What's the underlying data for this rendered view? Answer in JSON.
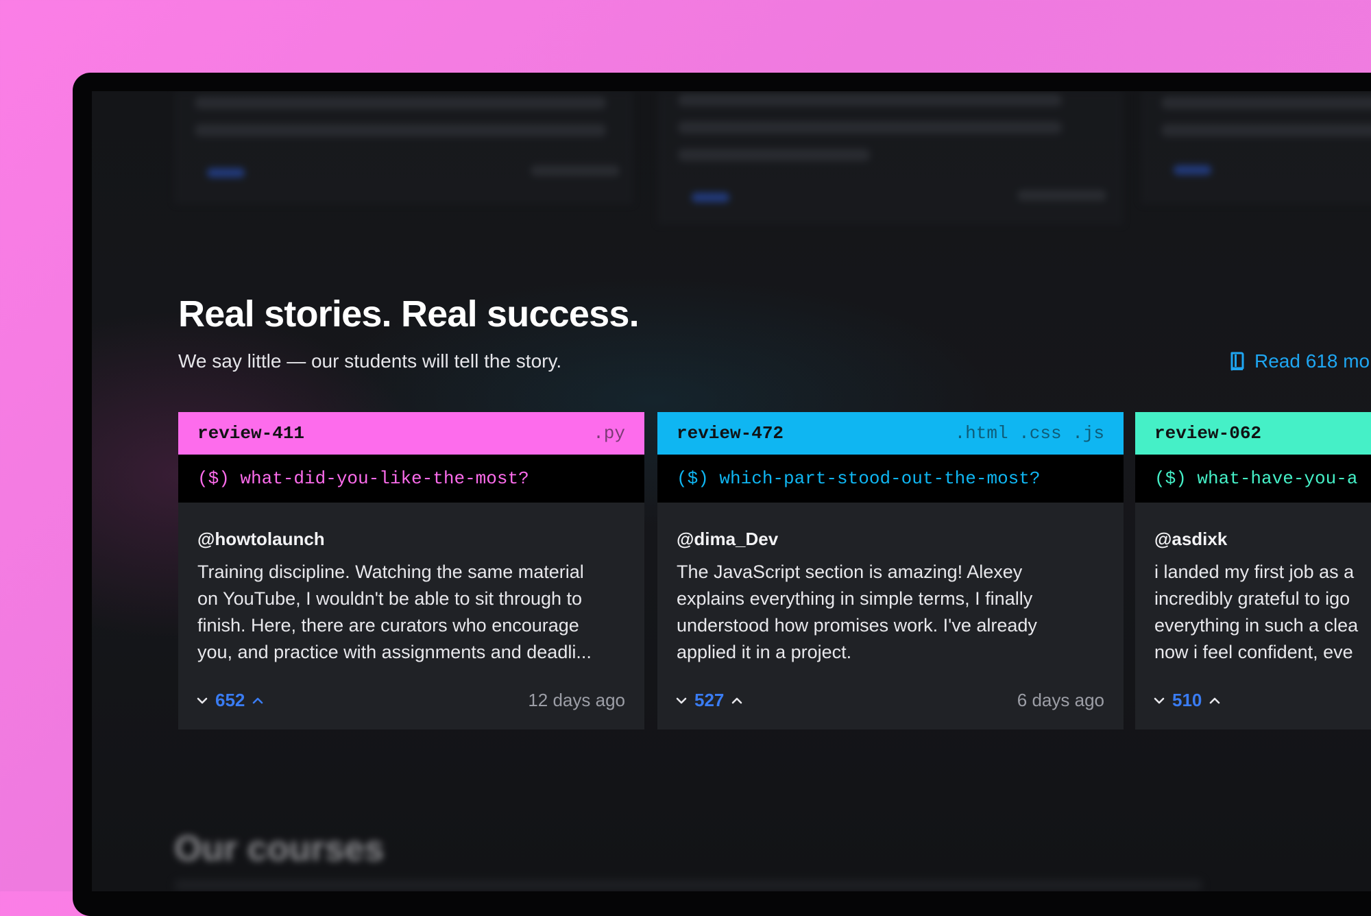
{
  "section": {
    "title": "Real stories. Real success.",
    "subtitle": "We say little — our students will tell the story.",
    "read_more": "Read 618 mo",
    "read_more_icon": "book-icon"
  },
  "reviews": [
    {
      "id": "review-411",
      "ext": ".py",
      "command": "($) what-did-you-like-the-most?",
      "accent": "#fd6cec",
      "user": "@howtolaunch",
      "text": "Training discipline. Watching the same material\non YouTube, I wouldn't be able to sit through to\nfinish. Here, there are curators who encourage\nyou, and practice with assignments and deadli...",
      "votes": "652",
      "time": "12 days ago"
    },
    {
      "id": "review-472",
      "ext": ".html .css .js",
      "command": "($) which-part-stood-out-the-most?",
      "accent": "#0fb6f2",
      "user": "@dima_Dev",
      "text": "The JavaScript section is amazing! Alexey\nexplains everything in simple terms, I finally\nunderstood how promises work. I've already\napplied it in a project.",
      "votes": "527",
      "time": "6 days ago"
    },
    {
      "id": "review-062",
      "ext": "",
      "command": "($) what-have-you-a",
      "accent": "#45f0c7",
      "user": "@asdixk",
      "text": "i landed my first job as a\nincredibly grateful to igo\neverything in such a clea\nnow i feel confident, eve",
      "votes": "510",
      "time": ""
    }
  ],
  "next_section": {
    "title": "Our courses"
  }
}
